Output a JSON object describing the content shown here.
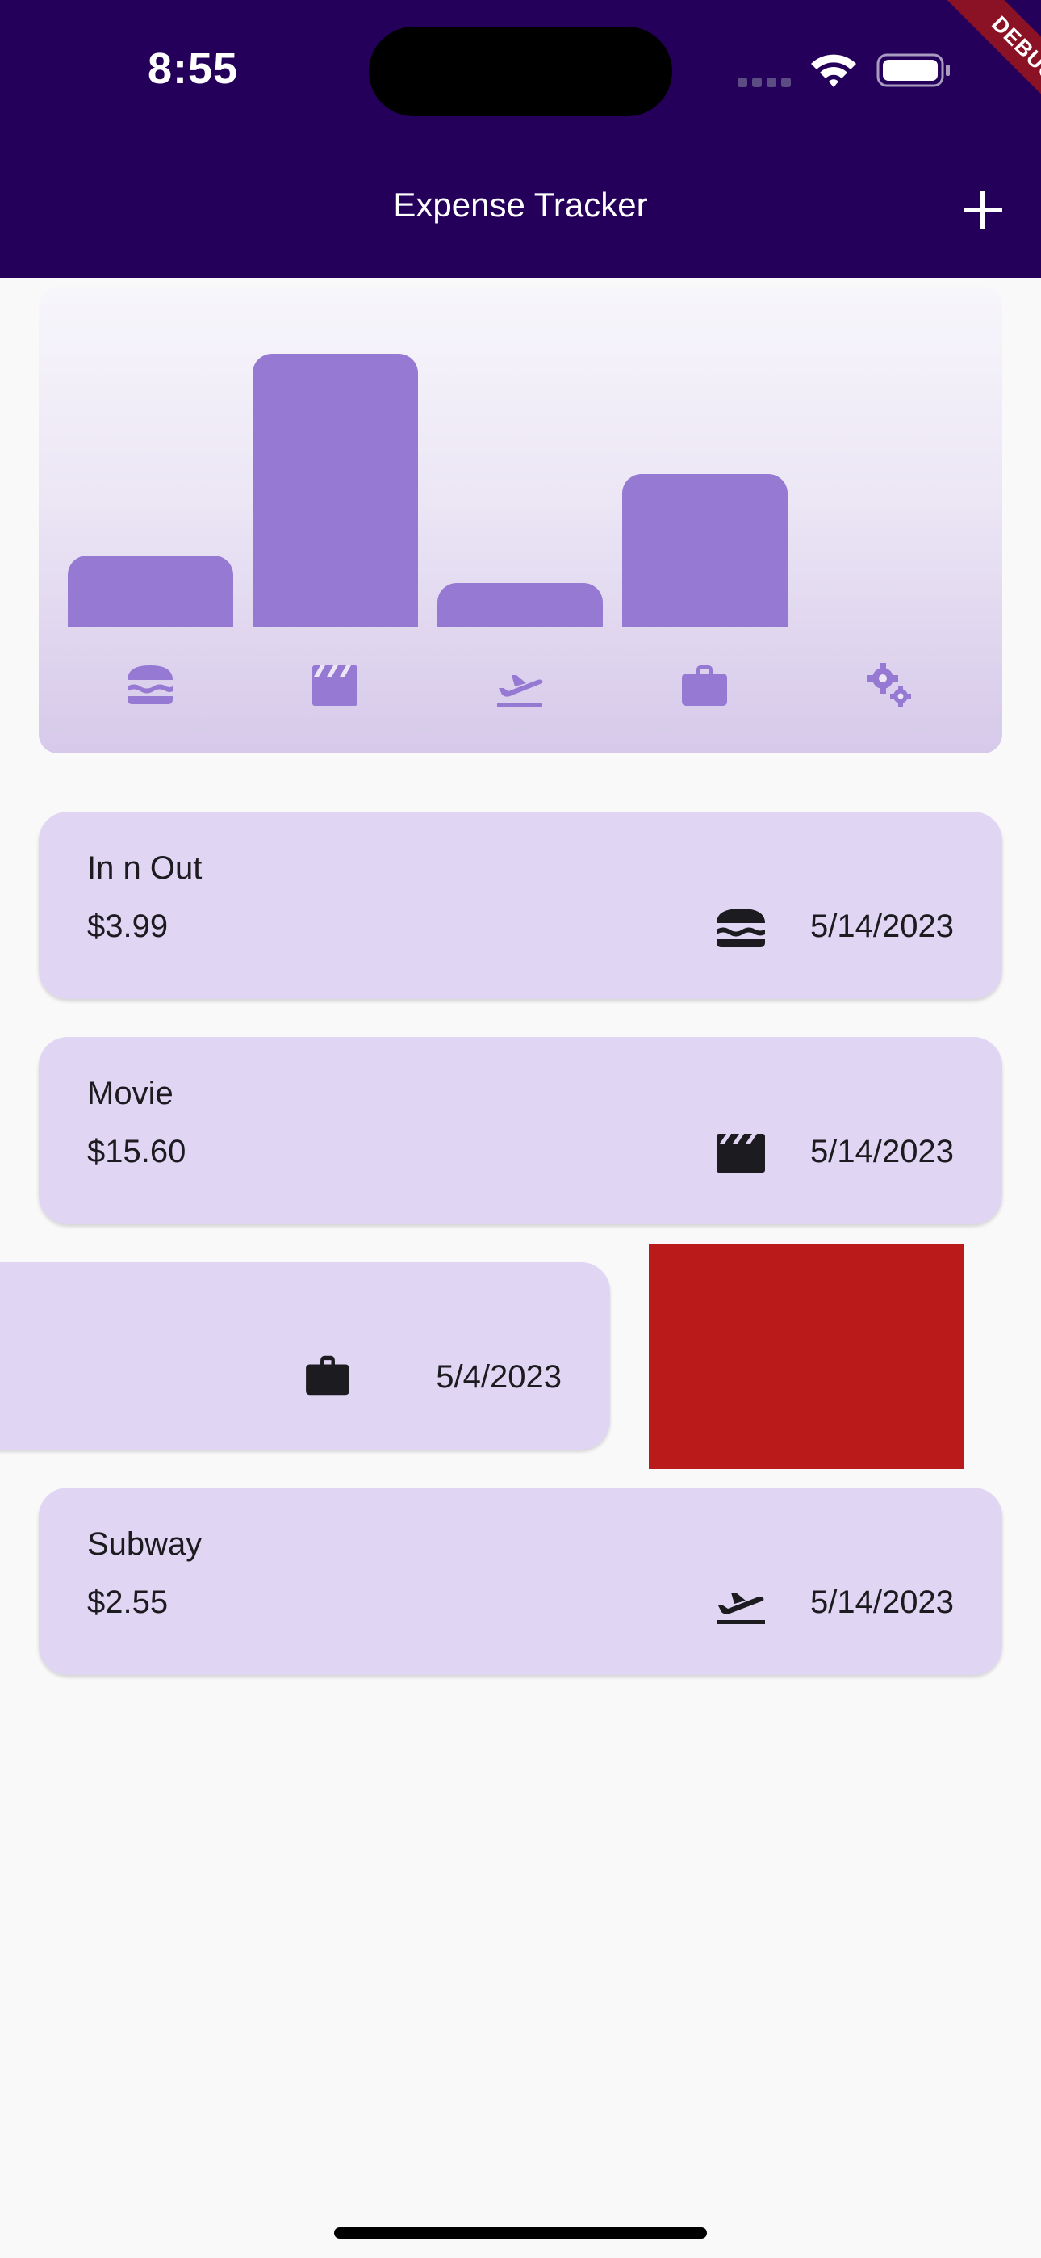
{
  "status_bar": {
    "time": "8:55"
  },
  "app_bar": {
    "title": "Expense Tracker",
    "add_icon": "plus-icon",
    "debug_label": "DEBUG"
  },
  "colors": {
    "app_bar": "#25005a",
    "bar": "#9579d3",
    "card": "#e1d5f4",
    "delete": "#ba1a1a"
  },
  "chart_data": {
    "type": "bar",
    "categories": [
      "food",
      "leisure",
      "travel",
      "work",
      "other"
    ],
    "category_icons": [
      "burger-icon",
      "clapperboard-icon",
      "plane-departure-icon",
      "briefcase-icon",
      "gears-icon"
    ],
    "values": [
      3.99,
      15.6,
      2.55,
      9.0,
      0
    ],
    "relative_heights": [
      0.26,
      1.0,
      0.16,
      0.56,
      0
    ]
  },
  "expenses": [
    {
      "title": "In n Out",
      "amount": "$3.99",
      "date": "5/14/2023",
      "icon": "burger-icon"
    },
    {
      "title": "Movie",
      "amount": "$15.60",
      "date": "5/14/2023",
      "icon": "clapperboard-icon"
    },
    {
      "title": "",
      "amount": "",
      "date": "5/4/2023",
      "icon": "briefcase-icon"
    },
    {
      "title": "Subway",
      "amount": "$2.55",
      "date": "5/14/2023",
      "icon": "plane-departure-icon"
    }
  ]
}
